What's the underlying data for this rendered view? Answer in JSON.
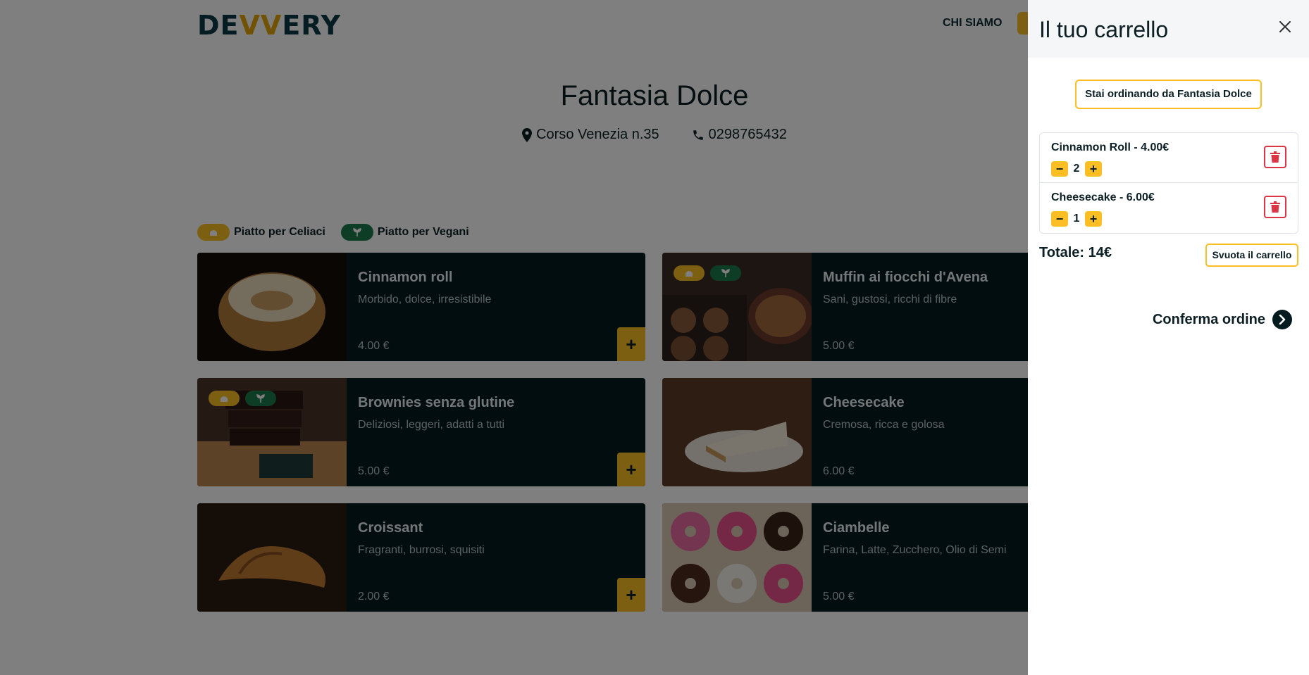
{
  "navbar": {
    "logo_prefix": "DE",
    "logo_accent": "VV",
    "logo_suffix": "ERY",
    "links": [
      "CHI SIAMO"
    ]
  },
  "restaurant": {
    "name": "Fantasia Dolce",
    "address": "Corso Venezia n.35",
    "phone": "0298765432"
  },
  "legend": {
    "celiac_label": "Piatto per Celiaci",
    "vegan_label": "Piatto per Vegani"
  },
  "products": [
    {
      "name": "Cinnamon roll",
      "description": "Morbido, dolce, irresistibile",
      "price": "4.00 €",
      "celiac": false,
      "vegan": false,
      "add_label": "+"
    },
    {
      "name": "Muffin ai fiocchi d'Avena",
      "description": "Sani, gustosi, ricchi di fibre",
      "price": "5.00 €",
      "celiac": true,
      "vegan": true,
      "add_label": "+"
    },
    {
      "name": "Brownies senza glutine",
      "description": "Deliziosi, leggeri, adatti a tutti",
      "price": "5.00 €",
      "celiac": true,
      "vegan": true,
      "add_label": "+"
    },
    {
      "name": "Cheesecake",
      "description": "Cremosa, ricca e golosa",
      "price": "6.00 €",
      "celiac": false,
      "vegan": false,
      "add_label": "+"
    },
    {
      "name": "Croissant",
      "description": "Fragranti, burrosi, squisiti",
      "price": "2.00 €",
      "celiac": false,
      "vegan": false,
      "add_label": "+"
    },
    {
      "name": "Ciambelle",
      "description": "Farina, Latte, Zucchero, Olio di Semi",
      "price": "5.00 €",
      "celiac": false,
      "vegan": false,
      "add_label": "+"
    }
  ],
  "cart": {
    "title": "Il tuo carrello",
    "ordering_from": "Stai ordinando da Fantasia Dolce",
    "items": [
      {
        "label": "Cinnamon Roll - 4.00€",
        "quantity": "2",
        "minus": "−",
        "plus": "+"
      },
      {
        "label": "Cheesecake - 6.00€",
        "quantity": "1",
        "minus": "−",
        "plus": "+"
      }
    ],
    "total": "Totale: 14€",
    "empty_label": "Svuota il carrello",
    "confirm_label": "Conferma ordine"
  },
  "colors": {
    "accent": "#fbbf24",
    "vegan": "#1b7a4b",
    "card_bg": "#031a1f",
    "danger": "#dc3545"
  }
}
